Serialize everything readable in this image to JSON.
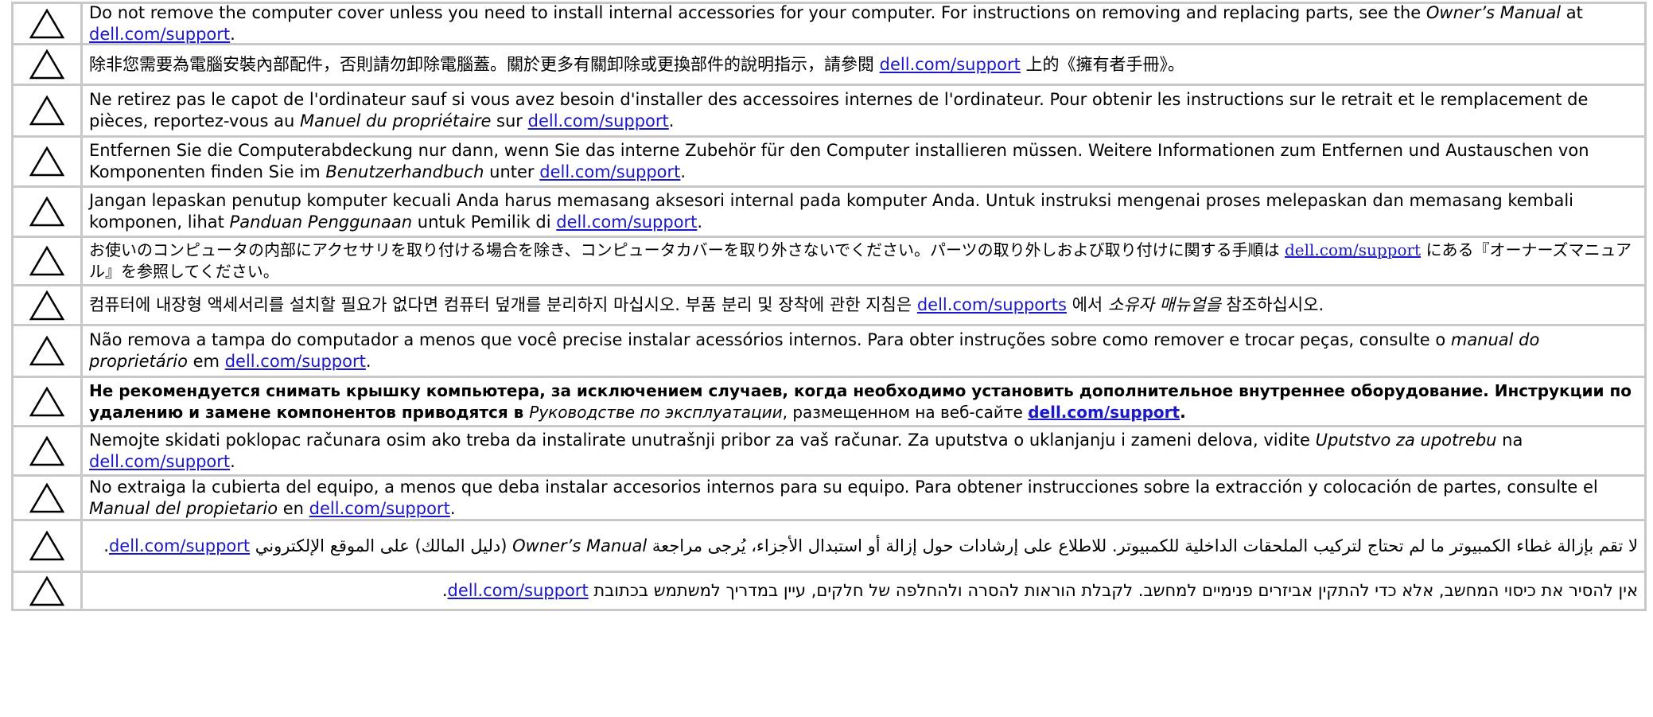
{
  "rows": [
    {
      "pre": "Do not remove the computer cover unless you need to install internal accessories for your computer. For instructions on removing and replacing parts, see the ",
      "em": "Owner’s Manual",
      "mid": " at ",
      "link": "dell.com/support",
      "post": "."
    },
    {
      "pre": "除非您需要為電腦安裝內部配件，否則請勿卸除電腦蓋。關於更多有關卸除或更換部件的說明指示，請參閱 ",
      "em": "",
      "mid": "",
      "link": "dell.com/support",
      "post": " 上的《擁有者手冊》。"
    },
    {
      "pre": "Ne retirez pas le capot de l'ordinateur sauf si vous avez besoin d'installer des accessoires internes de l'ordinateur. Pour obtenir les instructions sur le retrait et le remplacement de pièces, reportez-vous au ",
      "em": "Manuel du propriétaire",
      "mid": " sur ",
      "link": "dell.com/support",
      "post": "."
    },
    {
      "pre": "Entfernen Sie die Computerabdeckung nur dann, wenn Sie das interne Zubehör für den Computer installieren müssen. Weitere Informationen zum Entfernen und Austauschen von Komponenten finden Sie im ",
      "em": "Benutzerhandbuch",
      "mid": " unter ",
      "link": "dell.com/support",
      "post": "."
    },
    {
      "pre": "Jangan lepaskan penutup komputer kecuali Anda harus memasang aksesori internal pada komputer Anda. Untuk instruksi mengenai proses melepaskan dan memasang kembali komponen, lihat ",
      "em": "Panduan Penggunaan",
      "mid": " untuk Pemilik di ",
      "link": "dell.com/support",
      "post": "."
    },
    {
      "pre": "お使いのコンピュータの内部にアクセサリを取り付ける場合を除き、コンピュータカバーを取り外さないでください。パーツの取り外しおよび取り付けに関する手順は ",
      "em": "",
      "mid": "",
      "link": "dell.com/support",
      "post": " にある『オーナーズマニュアル』を参照してください。"
    },
    {
      "pre": "컴퓨터에 내장형 액세서리를 설치할 필요가 없다면 컴퓨터 덮개를 분리하지 마십시오. 부품 분리 및 장착에 관한 지침은 ",
      "em": "",
      "mid": "",
      "link": "dell.com/supports",
      "post": " 에서 ",
      "em2": "소유자 매뉴얼을",
      "post2": " 참조하십시오."
    },
    {
      "pre": "Não remova a tampa do computador a menos que você precise instalar acessórios internos. Para obter instruções sobre como remover e trocar peças, consulte o ",
      "em": "manual do proprietário",
      "mid": " em ",
      "link": "dell.com/support",
      "post": "."
    },
    {
      "pre": "Не рекомендуется снимать крышку компьютера, за исключением случаев, когда необходимо установить дополнительное внутреннее оборудование. Инструкции по удалению и замене компонентов приводятся в ",
      "em": "Руководстве по эксплуатации",
      "mid": ", размещенном на веб-сайте ",
      "link": "dell.com/support",
      "post": "."
    },
    {
      "pre": "Nemojte skidati poklopac računara osim ako treba da instalirate unutrašnji pribor za vaš računar. Za uputstva o uklanjanju i zameni delova, vidite ",
      "em": "Uputstvo za upotrebu",
      "mid": " na ",
      "link": "dell.com/support",
      "post": "."
    },
    {
      "pre": "No extraiga la cubierta del equipo, a menos que deba instalar accesorios internos para su equipo. Para obtener instrucciones sobre la extracción y colocación de partes, consulte el ",
      "em": "Manual del propietario",
      "mid": " en ",
      "link": "dell.com/support",
      "post": "."
    },
    {
      "pre": "لا تقم بإزالة غطاء الكمبيوتر ما لم تحتاج لتركيب الملحقات الداخلية للكمبيوتر. للاطلاع على إرشادات حول إزالة أو استبدال الأجزاء، يُرجى مراجعة ",
      "em": "Owner’s Manual",
      "mid": " (دليل المالك) على الموقع الإلكتروني ",
      "link": "dell.com/support",
      "post": "."
    },
    {
      "pre": "אין להסיר את כיסוי המחשב, אלא כדי להתקין אביזרים פנימיים למחשב. לקבלת הוראות להסרה ולהחלפה של חלקים, עיין במדריך למשתמש בכתובת ",
      "em": "",
      "mid": "",
      "link": "dell.com/support",
      "post": "."
    }
  ],
  "icon": "caution-triangle-icon"
}
